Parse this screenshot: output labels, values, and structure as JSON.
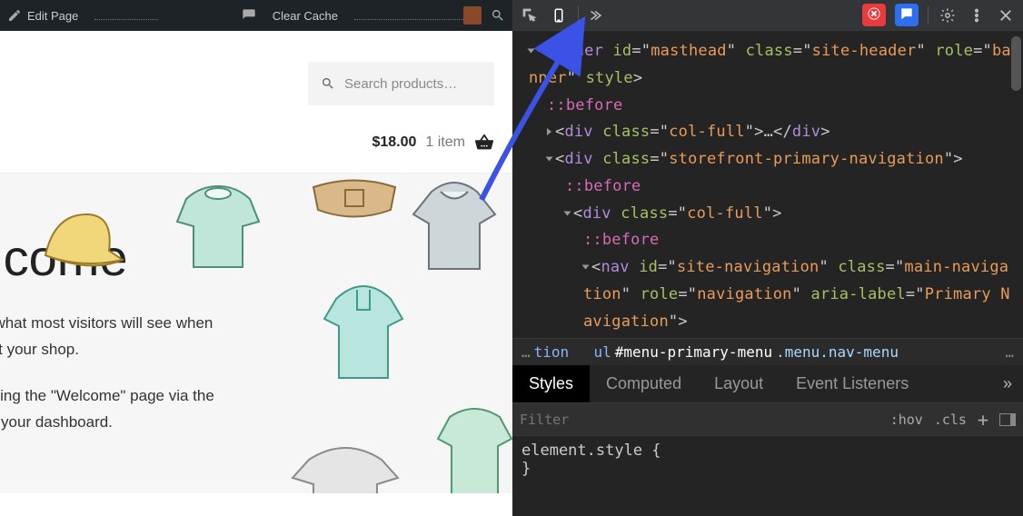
{
  "adminbar": {
    "edit": "Edit Page",
    "clear_cache": "Clear Cache"
  },
  "search": {
    "placeholder": "Search products…"
  },
  "cart": {
    "price": "$18.00",
    "count": "1 item"
  },
  "hero": {
    "title": "elcome",
    "p1a": "ich is what most visitors will see when",
    "p1b": "rst visit your shop.",
    "p2a": "by editing the \"Welcome\" page via the",
    "p2b": "enu in your dashboard."
  },
  "dom": {
    "l1_pre": "<",
    "l1_tag": "header",
    "l1_a1": "id",
    "l1_v1": "masthead",
    "l1_a2": "class",
    "l1_v2": "site-header",
    "l1_a3": "role",
    "l1_v3": "banner",
    "l1_a4": "style",
    "l1_close": ">",
    "before": "::before",
    "div": "div",
    "cls": "class",
    "colfull": "col-full",
    "dots": "…",
    "enddiv": "</",
    "enddiv2": ">",
    "spn": "storefront-primary-navigation",
    "nav": "nav",
    "navid": "site-navigation",
    "navcls": "main-navigation",
    "role": "role",
    "rolenav": "navigation",
    "arialbl": "aria-label",
    "ariaval": "Primary Navigation"
  },
  "crumbs": {
    "ell": "…",
    "tion": "tion",
    "ul": "ul",
    "id": "#menu-primary-menu",
    "cls": ".menu.nav-menu"
  },
  "panels": {
    "styles": "Styles",
    "computed": "Computed",
    "layout": "Layout",
    "events": "Event Listeners"
  },
  "filter": {
    "placeholder": "Filter",
    "hov": ":hov",
    "cls": ".cls"
  },
  "css": {
    "l1": "element.style {",
    "l2": "}"
  }
}
